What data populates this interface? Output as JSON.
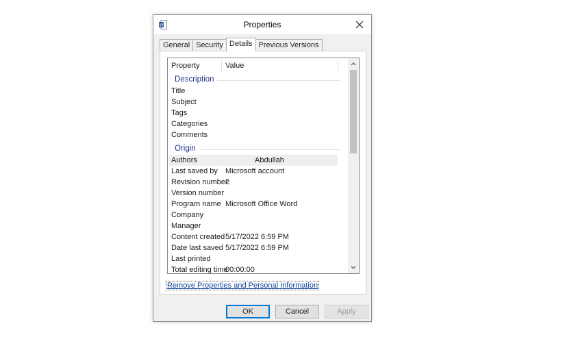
{
  "window": {
    "title": "Properties",
    "app_icon": "word-document-icon"
  },
  "tabs": [
    {
      "label": "General",
      "active": false
    },
    {
      "label": "Security",
      "active": false
    },
    {
      "label": "Details",
      "active": true
    },
    {
      "label": "Previous Versions",
      "active": false
    }
  ],
  "details": {
    "columns": {
      "property": "Property",
      "value": "Value"
    },
    "groups": {
      "description": "Description",
      "origin": "Origin"
    },
    "description_rows": [
      {
        "property": "Title",
        "value": ""
      },
      {
        "property": "Subject",
        "value": ""
      },
      {
        "property": "Tags",
        "value": ""
      },
      {
        "property": "Categories",
        "value": ""
      },
      {
        "property": "Comments",
        "value": ""
      }
    ],
    "origin_rows": [
      {
        "property": "Authors",
        "value": "Abdullah",
        "selected": true
      },
      {
        "property": "Last saved by",
        "value": "Microsoft account"
      },
      {
        "property": "Revision number",
        "value": "2"
      },
      {
        "property": "Version number",
        "value": ""
      },
      {
        "property": "Program name",
        "value": "Microsoft Office Word"
      },
      {
        "property": "Company",
        "value": ""
      },
      {
        "property": "Manager",
        "value": ""
      },
      {
        "property": "Content created",
        "value": "5/17/2022 6:59 PM"
      },
      {
        "property": "Date last saved",
        "value": "5/17/2022 6:59 PM"
      },
      {
        "property": "Last printed",
        "value": ""
      },
      {
        "property": "Total editing time",
        "value": "00:00:00"
      }
    ]
  },
  "remove_link": "Remove Properties and Personal Information",
  "buttons": {
    "ok": "OK",
    "cancel": "Cancel",
    "apply": "Apply"
  },
  "colors": {
    "accent": "#0078d7",
    "group_heading": "#1e3287",
    "link": "#0a3f9f"
  }
}
